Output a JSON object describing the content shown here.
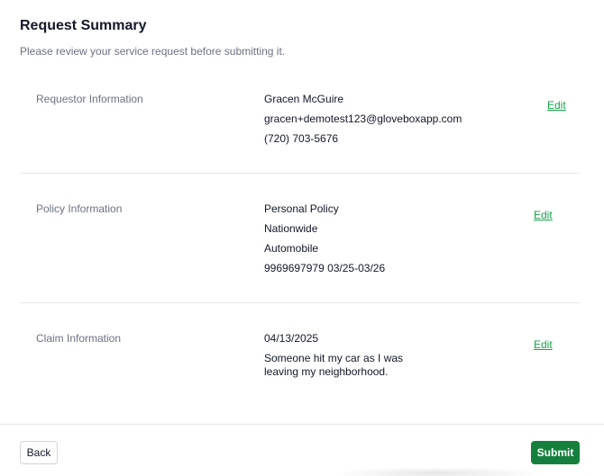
{
  "header": {
    "title": "Request Summary",
    "subtitle": "Please review your service request before submitting it."
  },
  "sections": [
    {
      "label": "Requestor Information",
      "values": [
        "Gracen McGuire",
        "gracen+demotest123@gloveboxapp.com",
        "(720) 703-5676"
      ],
      "edit_label": "Edit"
    },
    {
      "label": "Policy Information",
      "values": [
        "Personal Policy",
        "Nationwide",
        "Automobile",
        "9969697979 03/25-03/26"
      ],
      "edit_label": "Edit"
    },
    {
      "label": "Claim Information",
      "values": [
        "04/13/2025",
        "Someone hit my car as I was leaving my neighborhood."
      ],
      "edit_label": "Edit"
    }
  ],
  "footer": {
    "back_label": "Back",
    "submit_label": "Submit"
  },
  "colors": {
    "accent": "#15803d",
    "link": "#16a34a"
  }
}
